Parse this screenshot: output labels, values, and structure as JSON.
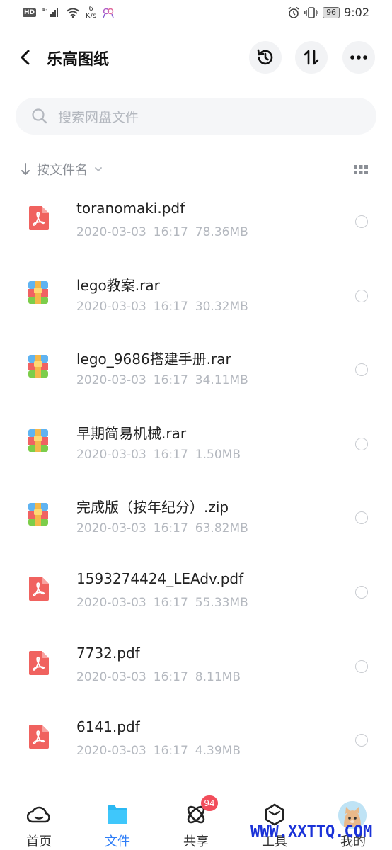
{
  "status_bar": {
    "hd": "HD",
    "network": "4G",
    "speed_value": "6",
    "speed_unit": "K/s",
    "battery": "96",
    "time": "9:02"
  },
  "header": {
    "title": "乐高图纸"
  },
  "search": {
    "placeholder": "搜索网盘文件"
  },
  "sort": {
    "label": "按文件名"
  },
  "files": [
    {
      "name": "toranomaki.pdf",
      "date": "2020-03-03",
      "time": "16:17",
      "size": "78.36MB",
      "type": "pdf"
    },
    {
      "name": "lego教案.rar",
      "date": "2020-03-03",
      "time": "16:17",
      "size": "30.32MB",
      "type": "rar"
    },
    {
      "name": "lego_9686搭建手册.rar",
      "date": "2020-03-03",
      "time": "16:17",
      "size": "34.11MB",
      "type": "rar"
    },
    {
      "name": "早期简易机械.rar",
      "date": "2020-03-03",
      "time": "16:17",
      "size": "1.50MB",
      "type": "rar"
    },
    {
      "name": "完成版（按年纪分）.zip",
      "date": "2020-03-03",
      "time": "16:17",
      "size": "63.82MB",
      "type": "zip"
    },
    {
      "name": "1593274424_LEAdv.pdf",
      "date": "2020-03-03",
      "time": "16:17",
      "size": "55.33MB",
      "type": "pdf"
    },
    {
      "name": "7732.pdf",
      "date": "2020-03-03",
      "time": "16:17",
      "size": "8.11MB",
      "type": "pdf"
    },
    {
      "name": "6141.pdf",
      "date": "2020-03-03",
      "time": "16:17",
      "size": "4.39MB",
      "type": "pdf"
    }
  ],
  "bottom_nav": {
    "home": "首页",
    "files": "文件",
    "share": "共享",
    "share_badge": "94",
    "tools": "工具",
    "me": "我的"
  },
  "watermark": "WWW.XXTTQ.COM",
  "colors": {
    "accent": "#2f7ef7",
    "pdf_icon": "#f0625f",
    "badge": "#f24d5b"
  }
}
